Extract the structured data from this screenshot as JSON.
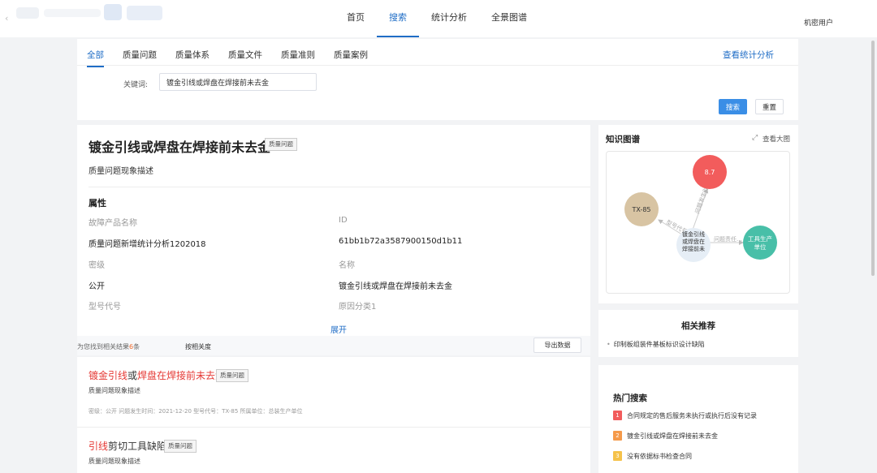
{
  "nav": {
    "items": [
      "首页",
      "搜索",
      "统计分析",
      "全景图谱"
    ],
    "active_index": 1,
    "user": "机密用户"
  },
  "search": {
    "categories": [
      "全部",
      "质量问题",
      "质量体系",
      "质量文件",
      "质量准则",
      "质量案例"
    ],
    "active_category": 0,
    "stats_link": "查看统计分析",
    "keyword_label": "关键词:",
    "keyword_value": "镀金引线或焊盘在焊接前未去金",
    "search_button": "搜索",
    "reset_button": "重置"
  },
  "detail": {
    "title": "镀金引线或焊盘在焊接前未去金",
    "tag": "质量问题",
    "description": "质量问题现象描述",
    "attributes_heading": "属性",
    "attributes": [
      {
        "label": "故障产品名称",
        "value": "质量问题新增统计分析1202018"
      },
      {
        "label": "ID",
        "value": "61bb1b72a3587900150d1b11"
      },
      {
        "label": "密级",
        "value": "公开"
      },
      {
        "label": "名称",
        "value": "镀金引线或焊盘在焊接前未去金"
      },
      {
        "label": "型号代号",
        "value": ""
      },
      {
        "label": "原因分类1",
        "value": ""
      }
    ],
    "expand": "展开"
  },
  "results_bar": {
    "found_prefix": "为您找到相关结果",
    "found_count": "6",
    "found_suffix": "条",
    "sort": "按相关度",
    "export": "导出数据"
  },
  "results": [
    {
      "title_parts": [
        {
          "text": "镀金引线",
          "hl": true
        },
        {
          "text": "或",
          "hl": false
        },
        {
          "text": "焊盘在焊接前未去金",
          "hl": true
        }
      ],
      "tag": "质量问题",
      "description": "质量问题现象描述",
      "meta": "密级：公开    问题发生时间：2021-12-20    型号代号：TX-85    所属单位：总装生产单位"
    },
    {
      "title_parts": [
        {
          "text": "引线",
          "hl": true
        },
        {
          "text": "剪切工具缺陷",
          "hl": false
        }
      ],
      "tag": "质量问题",
      "description": "质量问题现象描述",
      "meta": ""
    }
  ],
  "graph": {
    "title": "知识图谱",
    "view_large": "查看大图",
    "nodes": [
      {
        "id": "center",
        "label": "镀金引线或焊盘在焊接前未",
        "color": "#e6eef6"
      },
      {
        "id": "n1",
        "label": "8.7",
        "color": "#f25c5c"
      },
      {
        "id": "n2",
        "label": "TX-85",
        "color": "#d8c4a3"
      },
      {
        "id": "n3",
        "label": "工具生产单位",
        "color": "#48bfa8"
      }
    ],
    "edges": [
      {
        "from": "center",
        "to": "n1",
        "label": "问题发生时间"
      },
      {
        "from": "center",
        "to": "n2",
        "label": "型号代号"
      },
      {
        "from": "center",
        "to": "n3",
        "label": "问题责任..."
      }
    ]
  },
  "recommend": {
    "title": "相关推荐",
    "items": [
      "印制板组装件基板标识设计缺陷"
    ]
  },
  "hot": {
    "title": "热门搜索",
    "items": [
      {
        "rank": "1",
        "text": "合同规定的售后服务未执行或执行后没有记录",
        "color": "#f25c5c"
      },
      {
        "rank": "2",
        "text": "镀金引线或焊盘在焊接前未去金",
        "color": "#f59a4a"
      },
      {
        "rank": "3",
        "text": "没有依据标书检查合同",
        "color": "#f5c24a"
      }
    ]
  }
}
